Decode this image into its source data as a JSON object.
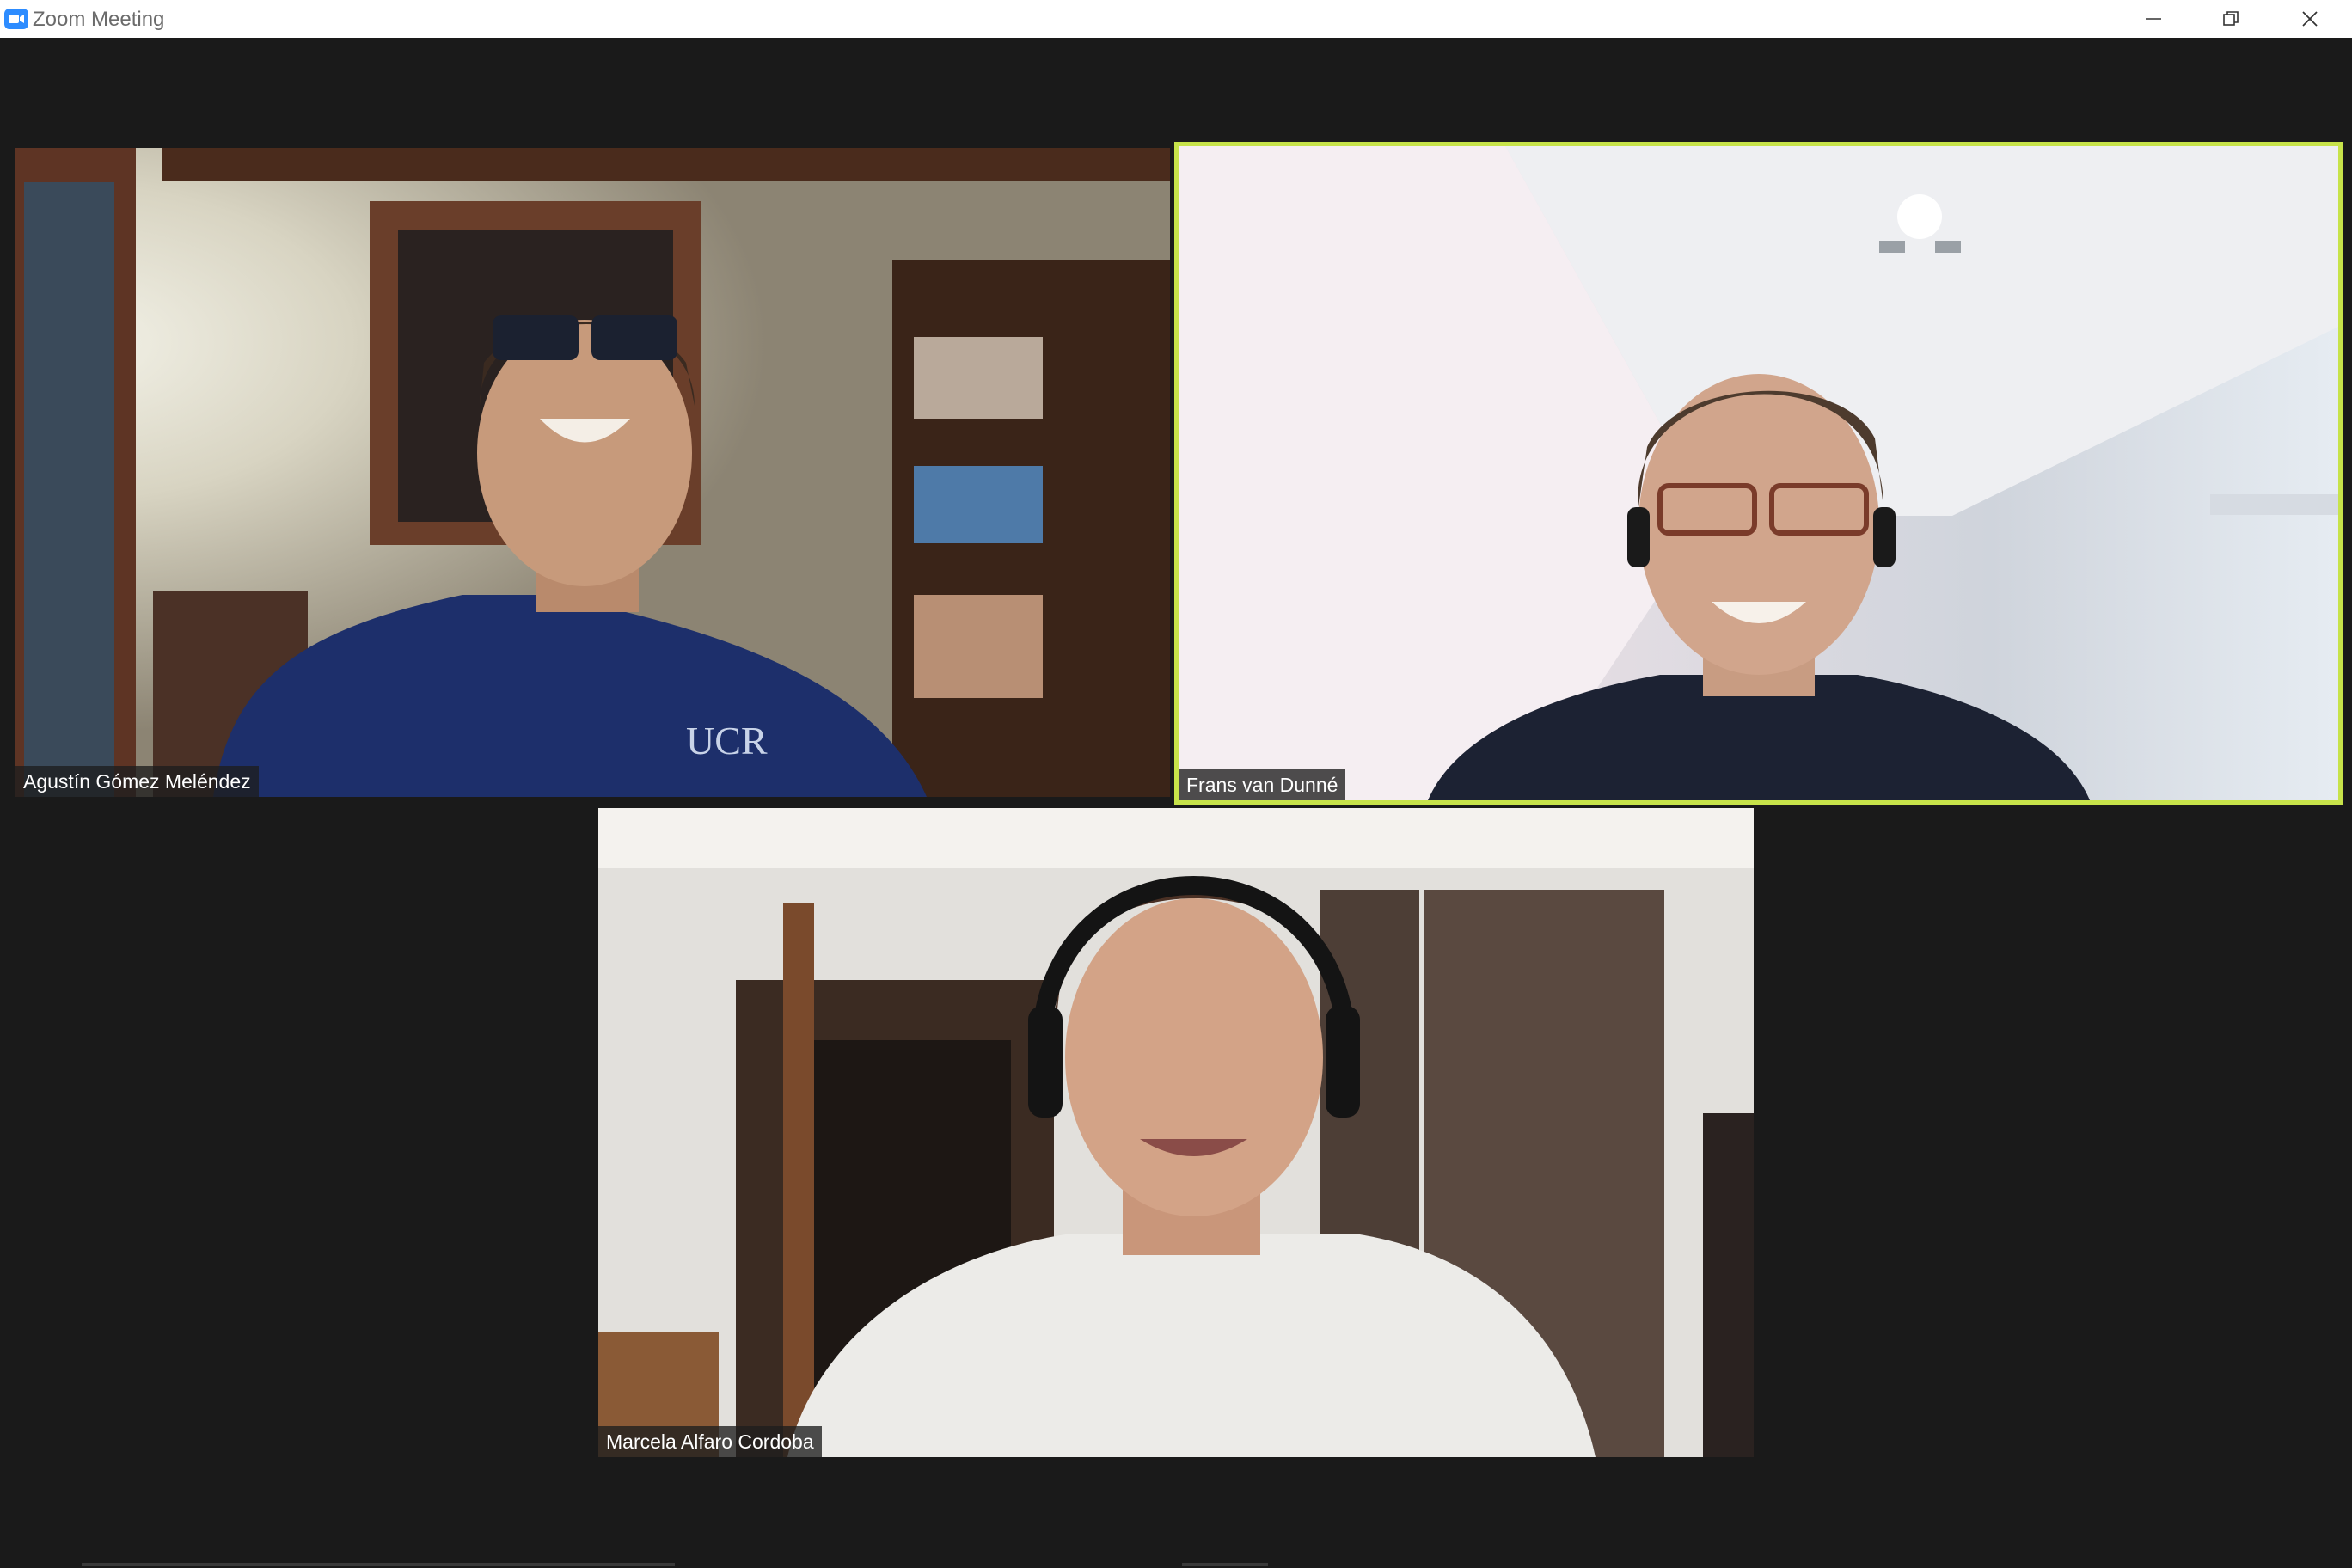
{
  "window": {
    "title": "Zoom Meeting",
    "controls": {
      "minimize": "minimize-icon",
      "restore": "restore-icon",
      "close": "close-icon"
    }
  },
  "participants": [
    {
      "name": "Agustín Gómez Meléndez",
      "shirt_logo": "UCR",
      "active_speaker": false
    },
    {
      "name": "Frans van Dunné",
      "active_speaker": true
    },
    {
      "name": "Marcela Alfaro Cordoba",
      "active_speaker": false
    }
  ],
  "colors": {
    "background": "#1a1a1a",
    "active_speaker_border": "#c7e34a",
    "titlebar": "#ffffff",
    "zoom_blue": "#2d8cff"
  }
}
